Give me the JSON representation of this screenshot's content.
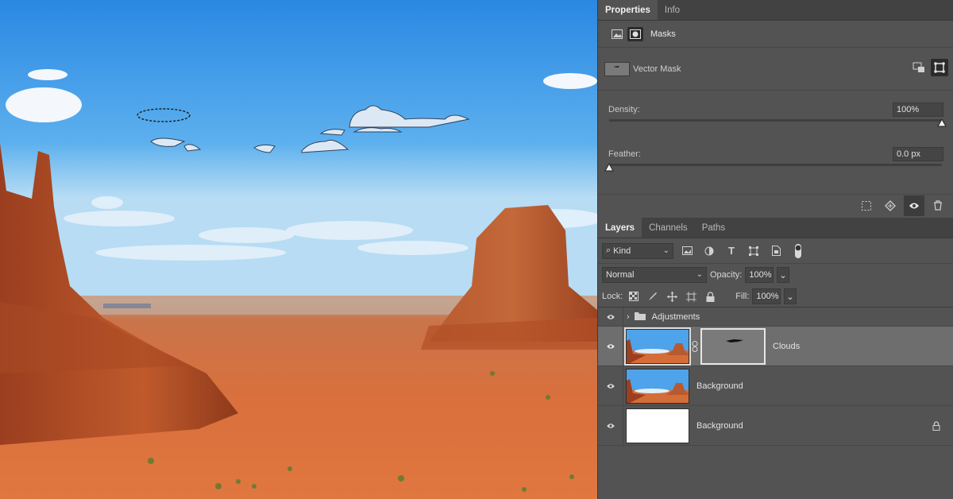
{
  "properties_panel": {
    "tabs": [
      "Properties",
      "Info"
    ],
    "active_tab": "Properties",
    "section_label": "Masks",
    "mask_type_label": "Vector Mask",
    "density": {
      "label": "Density:",
      "value": "100%",
      "level": 1.0
    },
    "feather": {
      "label": "Feather:",
      "value": "0.0 px",
      "level": 0.0
    }
  },
  "layers_panel": {
    "tabs": [
      "Layers",
      "Channels",
      "Paths"
    ],
    "active_tab": "Layers",
    "filter_kind": "Kind",
    "blend_mode": "Normal",
    "opacity_label": "Opacity:",
    "opacity_value": "100%",
    "lock_label": "Lock:",
    "fill_label": "Fill:",
    "fill_value": "100%",
    "layers": [
      {
        "name": "Adjustments",
        "type": "group",
        "visible": true
      },
      {
        "name": "Clouds",
        "type": "image-with-vector-mask",
        "visible": true,
        "selected": true
      },
      {
        "name": "Background",
        "type": "image",
        "visible": true
      },
      {
        "name": "Background",
        "type": "fill-white",
        "visible": true,
        "locked": true
      }
    ]
  },
  "icons": {
    "eye": "eye-icon",
    "lock": "lock-icon",
    "folder": "folder-icon",
    "chain": "link-icon",
    "trash": "trash-icon"
  },
  "colors": {
    "panel_bg": "#535353",
    "tab_bar": "#424242",
    "selected_layer": "#6e6e6e",
    "sky_top": "#2f8ee6",
    "rock": "#b7532a"
  }
}
